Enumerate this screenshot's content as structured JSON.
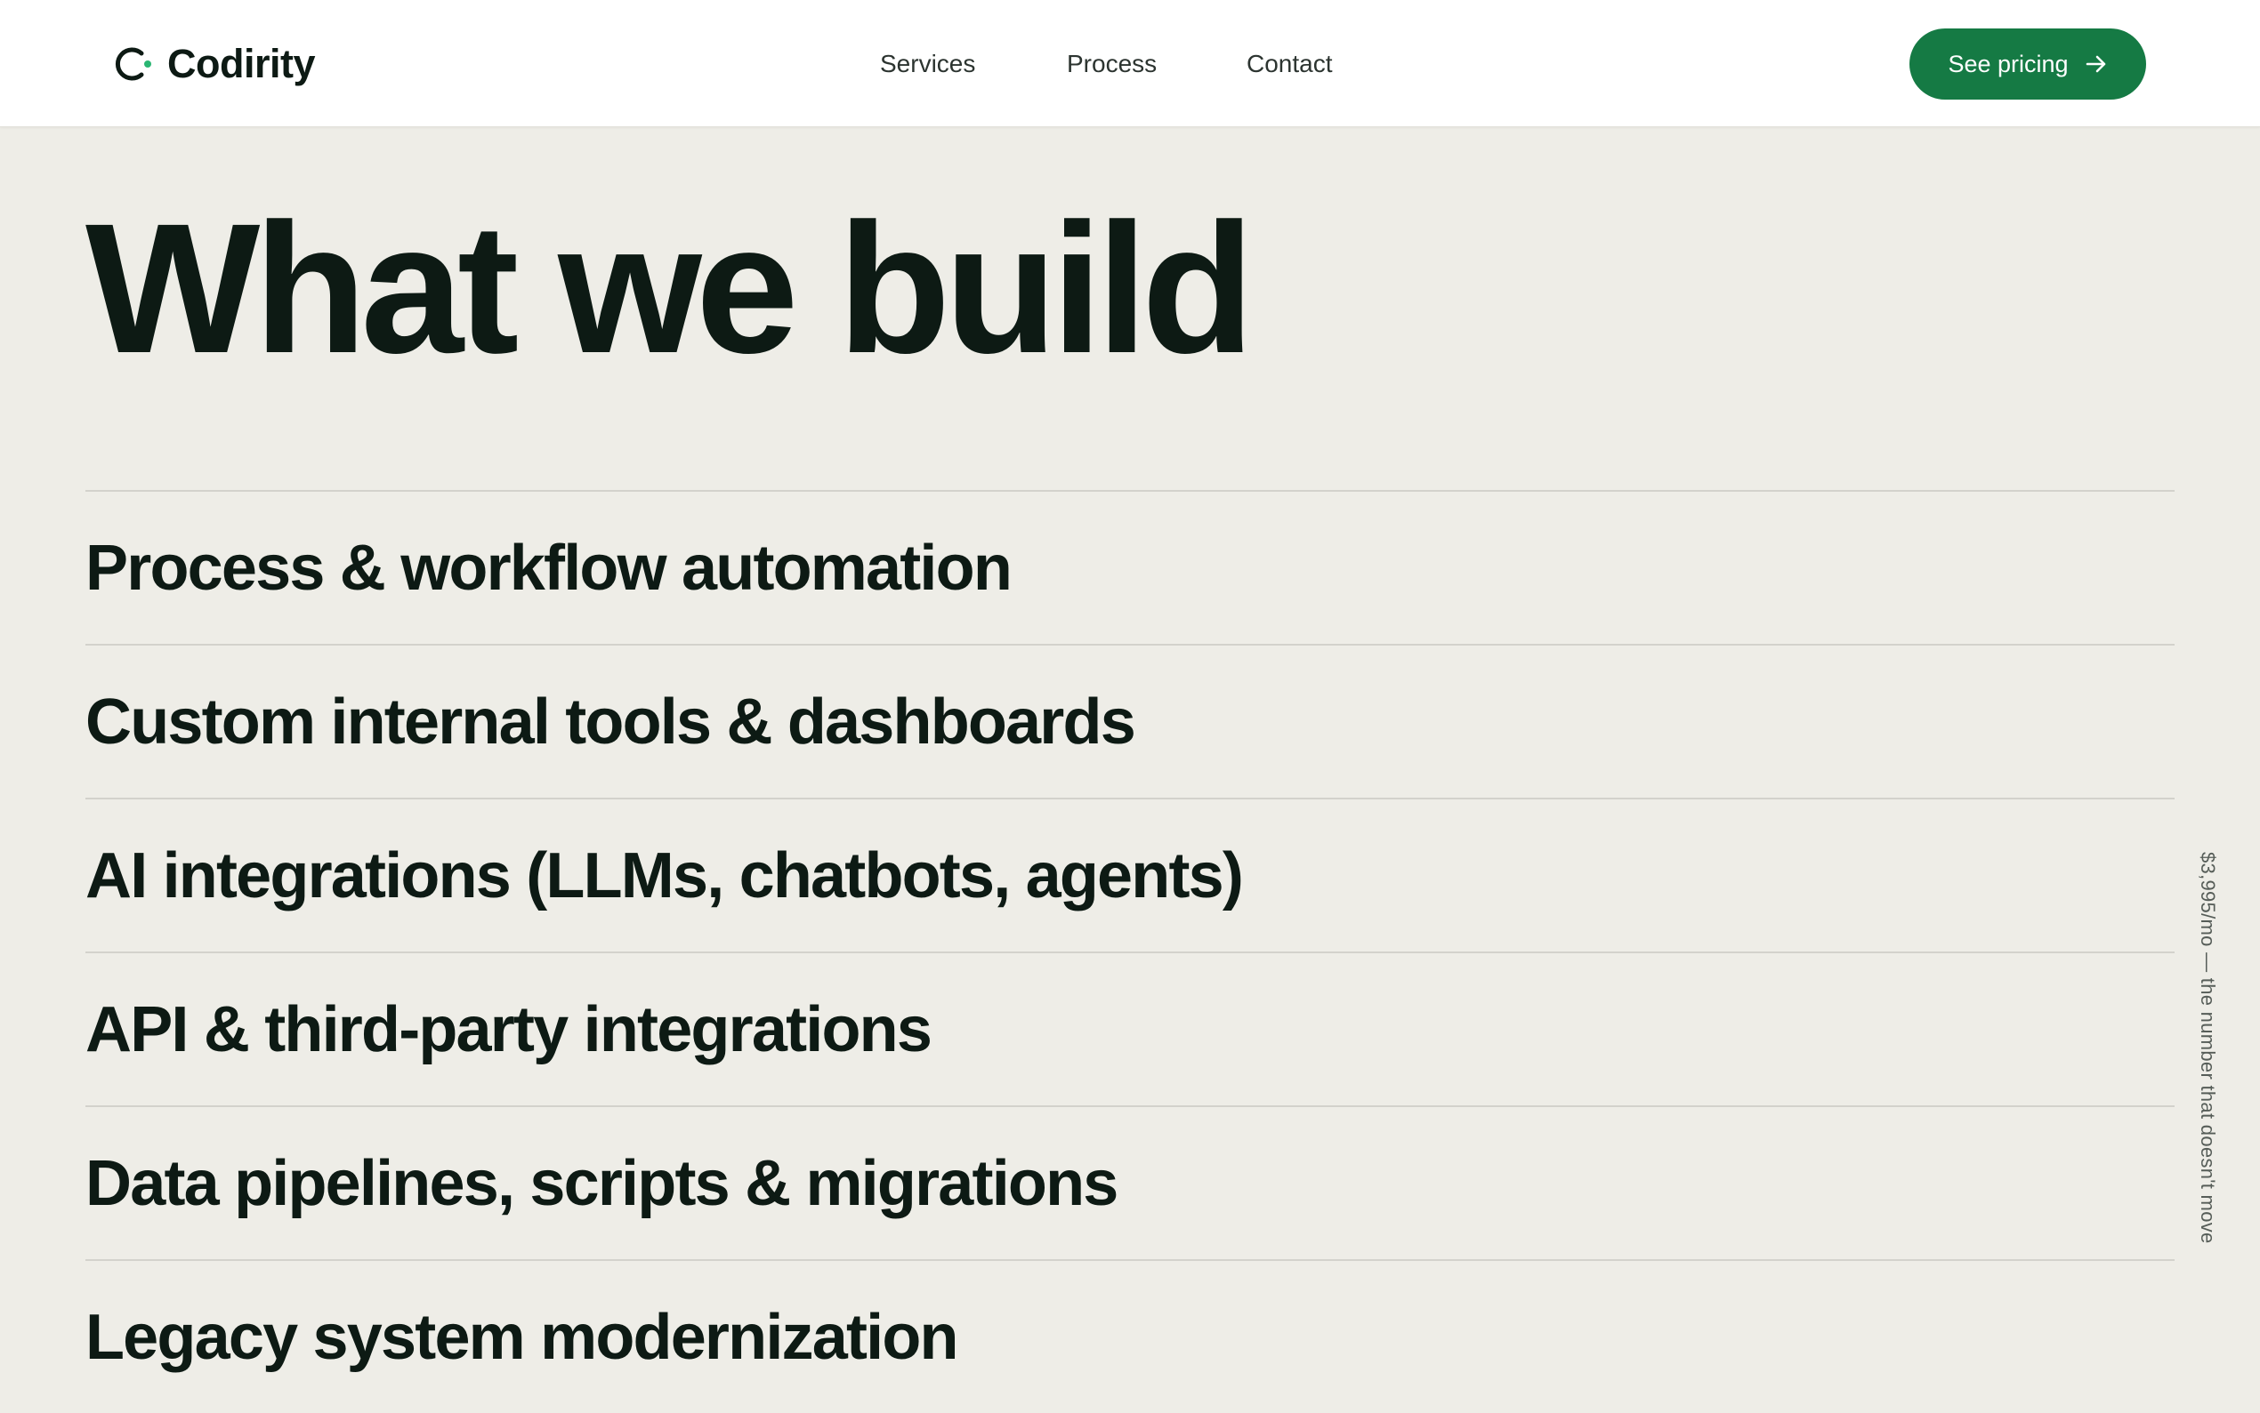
{
  "brand": {
    "name": "Codirity",
    "accent_color": "#157a44",
    "dot_color": "#2bb673"
  },
  "nav": {
    "items": [
      {
        "label": "Services"
      },
      {
        "label": "Process"
      },
      {
        "label": "Contact"
      }
    ]
  },
  "cta": {
    "label": "See pricing",
    "icon": "arrow-right-icon"
  },
  "hero": {
    "title": "What we build"
  },
  "services": [
    {
      "label": "Process & workflow automation"
    },
    {
      "label": "Custom internal tools & dashboards"
    },
    {
      "label": "AI integrations (LLMs, chatbots, agents)"
    },
    {
      "label": "API & third-party integrations"
    },
    {
      "label": "Data pipelines, scripts & migrations"
    },
    {
      "label": "Legacy system modernization"
    }
  ],
  "side_note": "$3,995/mo — the number that doesn't move"
}
